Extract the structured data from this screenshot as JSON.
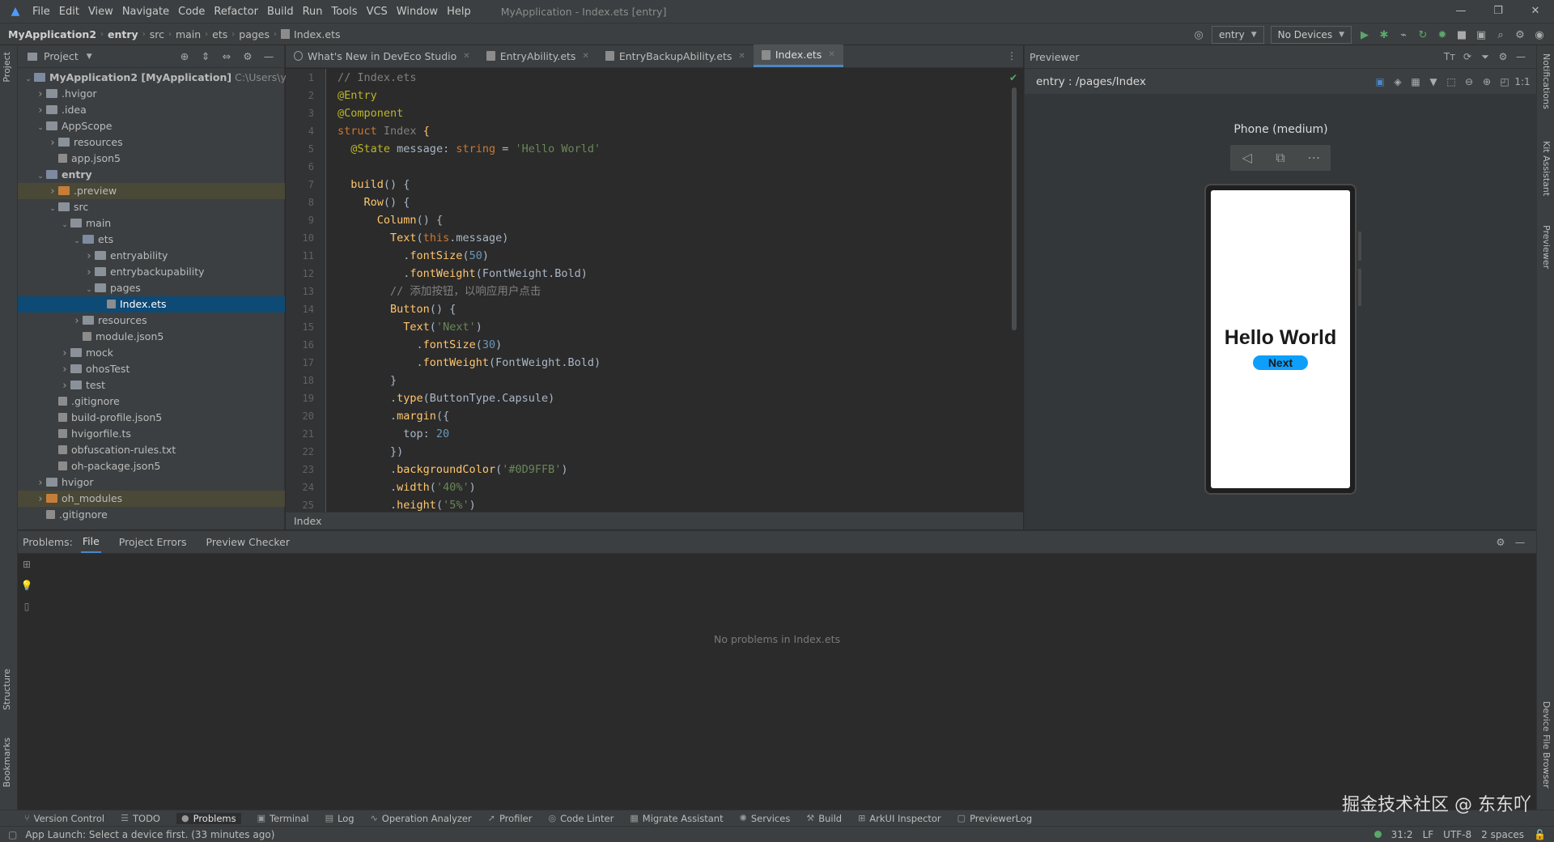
{
  "titlebar": {
    "menu": [
      "File",
      "Edit",
      "View",
      "Navigate",
      "Code",
      "Refactor",
      "Build",
      "Run",
      "Tools",
      "VCS",
      "Window",
      "Help"
    ],
    "window_title": "MyApplication - Index.ets [entry]"
  },
  "navbar": {
    "crumbs": [
      "MyApplication2",
      "entry",
      "src",
      "main",
      "ets",
      "pages",
      "Index.ets"
    ],
    "module": "entry",
    "devices": "No Devices"
  },
  "project": {
    "title": "Project",
    "tree": [
      {
        "depth": 0,
        "arrow": "v",
        "icon": "foldb",
        "label": "MyApplication2 [MyApplication]",
        "suffix": " C:\\Users\\y\\Dev",
        "bold": true
      },
      {
        "depth": 1,
        "arrow": ">",
        "icon": "fold",
        "label": ".hvigor"
      },
      {
        "depth": 1,
        "arrow": ">",
        "icon": "fold",
        "label": ".idea"
      },
      {
        "depth": 1,
        "arrow": "v",
        "icon": "fold",
        "label": "AppScope"
      },
      {
        "depth": 2,
        "arrow": ">",
        "icon": "fold",
        "label": "resources"
      },
      {
        "depth": 2,
        "arrow": "",
        "icon": "file",
        "label": "app.json5"
      },
      {
        "depth": 1,
        "arrow": "v",
        "icon": "foldb",
        "label": "entry",
        "bold": true
      },
      {
        "depth": 2,
        "arrow": ">",
        "icon": "foldo",
        "label": ".preview",
        "hl": "orange"
      },
      {
        "depth": 2,
        "arrow": "v",
        "icon": "fold",
        "label": "src"
      },
      {
        "depth": 3,
        "arrow": "v",
        "icon": "fold",
        "label": "main"
      },
      {
        "depth": 4,
        "arrow": "v",
        "icon": "foldb",
        "label": "ets"
      },
      {
        "depth": 5,
        "arrow": ">",
        "icon": "fold",
        "label": "entryability"
      },
      {
        "depth": 5,
        "arrow": ">",
        "icon": "fold",
        "label": "entrybackupability"
      },
      {
        "depth": 5,
        "arrow": "v",
        "icon": "fold",
        "label": "pages"
      },
      {
        "depth": 6,
        "arrow": "",
        "icon": "file",
        "label": "Index.ets",
        "hl": "sel"
      },
      {
        "depth": 4,
        "arrow": ">",
        "icon": "fold",
        "label": "resources"
      },
      {
        "depth": 4,
        "arrow": "",
        "icon": "file",
        "label": "module.json5"
      },
      {
        "depth": 3,
        "arrow": ">",
        "icon": "fold",
        "label": "mock"
      },
      {
        "depth": 3,
        "arrow": ">",
        "icon": "fold",
        "label": "ohosTest"
      },
      {
        "depth": 3,
        "arrow": ">",
        "icon": "fold",
        "label": "test"
      },
      {
        "depth": 2,
        "arrow": "",
        "icon": "file",
        "label": ".gitignore"
      },
      {
        "depth": 2,
        "arrow": "",
        "icon": "file",
        "label": "build-profile.json5"
      },
      {
        "depth": 2,
        "arrow": "",
        "icon": "file",
        "label": "hvigorfile.ts"
      },
      {
        "depth": 2,
        "arrow": "",
        "icon": "file",
        "label": "obfuscation-rules.txt"
      },
      {
        "depth": 2,
        "arrow": "",
        "icon": "file",
        "label": "oh-package.json5"
      },
      {
        "depth": 1,
        "arrow": ">",
        "icon": "fold",
        "label": "hvigor"
      },
      {
        "depth": 1,
        "arrow": ">",
        "icon": "foldo",
        "label": "oh_modules",
        "hl": "orange"
      },
      {
        "depth": 1,
        "arrow": "",
        "icon": "file",
        "label": ".gitignore"
      }
    ]
  },
  "editor": {
    "tabs": [
      {
        "label": "What's New in DevEco Studio",
        "active": false
      },
      {
        "label": "EntryAbility.ets",
        "active": false
      },
      {
        "label": "EntryBackupAbility.ets",
        "active": false
      },
      {
        "label": "Index.ets",
        "active": true
      }
    ],
    "footer": "Index",
    "lines": [
      [
        [
          "cm",
          "// Index.ets"
        ]
      ],
      [
        [
          "an",
          "@Entry"
        ]
      ],
      [
        [
          "an",
          "@Component"
        ]
      ],
      [
        [
          "kw",
          "struct "
        ],
        [
          "cn",
          "Index "
        ],
        [
          "fn",
          "{"
        ]
      ],
      [
        [
          "wh",
          "  "
        ],
        [
          "an",
          "@State "
        ],
        [
          "wh",
          "message: "
        ],
        [
          "kw",
          "string "
        ],
        [
          "wh",
          "= "
        ],
        [
          "st",
          "'Hello World'"
        ]
      ],
      [
        [
          "wh",
          ""
        ]
      ],
      [
        [
          "wh",
          "  "
        ],
        [
          "fn",
          "build"
        ],
        [
          "wh",
          "() {"
        ]
      ],
      [
        [
          "wh",
          "    "
        ],
        [
          "fn",
          "Row"
        ],
        [
          "wh",
          "() {"
        ]
      ],
      [
        [
          "wh",
          "      "
        ],
        [
          "fn",
          "Column"
        ],
        [
          "wh",
          "() {"
        ]
      ],
      [
        [
          "wh",
          "        "
        ],
        [
          "fn",
          "Text"
        ],
        [
          "wh",
          "("
        ],
        [
          "kw",
          "this"
        ],
        [
          "wh",
          ".message)"
        ]
      ],
      [
        [
          "wh",
          "          ."
        ],
        [
          "fn",
          "fontSize"
        ],
        [
          "wh",
          "("
        ],
        [
          "nm",
          "50"
        ],
        [
          "wh",
          ")"
        ]
      ],
      [
        [
          "wh",
          "          ."
        ],
        [
          "fn",
          "fontWeight"
        ],
        [
          "wh",
          "(FontWeight.Bold)"
        ]
      ],
      [
        [
          "wh",
          "        "
        ],
        [
          "cm",
          "// 添加按钮，以响应用户点击"
        ]
      ],
      [
        [
          "wh",
          "        "
        ],
        [
          "fn",
          "Button"
        ],
        [
          "wh",
          "() {"
        ]
      ],
      [
        [
          "wh",
          "          "
        ],
        [
          "fn",
          "Text"
        ],
        [
          "wh",
          "("
        ],
        [
          "st",
          "'Next'"
        ],
        [
          "wh",
          ")"
        ]
      ],
      [
        [
          "wh",
          "            ."
        ],
        [
          "fn",
          "fontSize"
        ],
        [
          "wh",
          "("
        ],
        [
          "nm",
          "30"
        ],
        [
          "wh",
          ")"
        ]
      ],
      [
        [
          "wh",
          "            ."
        ],
        [
          "fn",
          "fontWeight"
        ],
        [
          "wh",
          "(FontWeight.Bold)"
        ]
      ],
      [
        [
          "wh",
          "        }"
        ]
      ],
      [
        [
          "wh",
          "        ."
        ],
        [
          "fn",
          "type"
        ],
        [
          "wh",
          "(ButtonType.Capsule)"
        ]
      ],
      [
        [
          "wh",
          "        ."
        ],
        [
          "fn",
          "margin"
        ],
        [
          "wh",
          "({"
        ]
      ],
      [
        [
          "wh",
          "          top: "
        ],
        [
          "nm",
          "20"
        ]
      ],
      [
        [
          "wh",
          "        })"
        ]
      ],
      [
        [
          "wh",
          "        ."
        ],
        [
          "fn",
          "backgroundColor"
        ],
        [
          "wh",
          "("
        ],
        [
          "st",
          "'#0D9FFB'"
        ],
        [
          "wh",
          ")"
        ]
      ],
      [
        [
          "wh",
          "        ."
        ],
        [
          "fn",
          "width"
        ],
        [
          "wh",
          "("
        ],
        [
          "st",
          "'40%'"
        ],
        [
          "wh",
          ")"
        ]
      ],
      [
        [
          "wh",
          "        ."
        ],
        [
          "fn",
          "height"
        ],
        [
          "wh",
          "("
        ],
        [
          "st",
          "'5%'"
        ],
        [
          "wh",
          ")"
        ]
      ]
    ]
  },
  "previewer": {
    "title": "Previewer",
    "path": "entry : /pages/Index",
    "device": "Phone (medium)",
    "hello": "Hello World",
    "button": "Next",
    "button_color": "#0D9FFB"
  },
  "problems": {
    "label": "Problems:",
    "tabs": [
      {
        "label": "File",
        "active": true
      },
      {
        "label": "Project Errors",
        "active": false
      },
      {
        "label": "Preview Checker",
        "active": false
      }
    ],
    "empty": "No problems in Index.ets"
  },
  "toolwindows": [
    {
      "icon": "⑂",
      "label": "Version Control"
    },
    {
      "icon": "☰",
      "label": "TODO"
    },
    {
      "icon": "●",
      "label": "Problems",
      "active": true
    },
    {
      "icon": "▣",
      "label": "Terminal"
    },
    {
      "icon": "▤",
      "label": "Log"
    },
    {
      "icon": "∿",
      "label": "Operation Analyzer"
    },
    {
      "icon": "➚",
      "label": "Profiler"
    },
    {
      "icon": "◎",
      "label": "Code Linter"
    },
    {
      "icon": "▦",
      "label": "Migrate Assistant"
    },
    {
      "icon": "✺",
      "label": "Services"
    },
    {
      "icon": "⚒",
      "label": "Build"
    },
    {
      "icon": "⊞",
      "label": "ArkUI Inspector"
    },
    {
      "icon": "▢",
      "label": "PreviewerLog"
    }
  ],
  "sidestrip": {
    "left_top": "Project",
    "left_bottom1": "Structure",
    "left_bottom2": "Bookmarks",
    "right": [
      "Notifications",
      "Kit Assistant",
      "Previewer"
    ],
    "right_bottom": "Device File Browser"
  },
  "status": {
    "message": "App Launch: Select a device first. (33 minutes ago)",
    "position": "31:2",
    "line_sep": "LF",
    "encoding": "UTF-8",
    "indent": "2 spaces"
  },
  "watermark": "掘金技术社区 @ 东东吖"
}
